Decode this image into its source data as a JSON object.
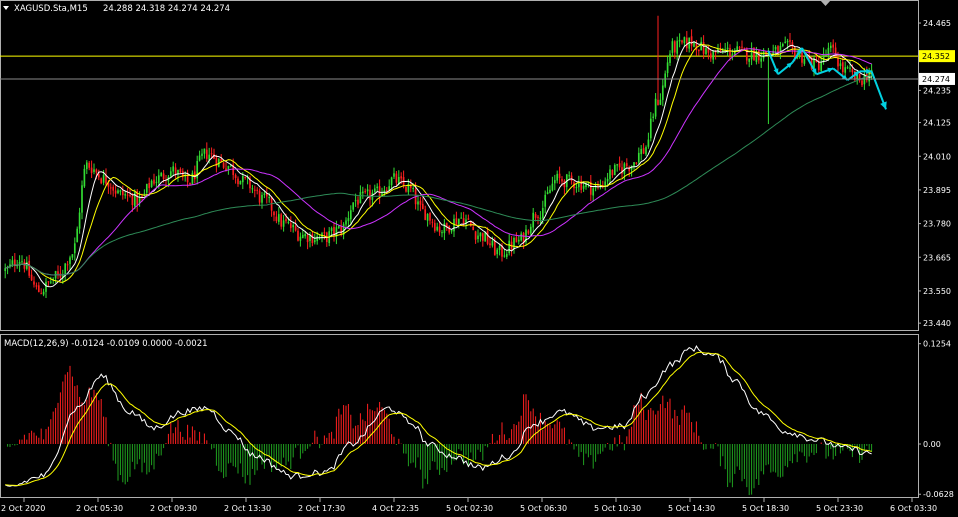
{
  "chart_data": {
    "type": "candlestick",
    "symbol_label": "XAGUSD.Sta,M15",
    "ohlc_label": "24.288 24.318 24.274 24.274",
    "price_axis": {
      "ylim": [
        23.42,
        24.53
      ],
      "ticks": [
        "24.465",
        "24.350",
        "24.235",
        "24.125",
        "24.010",
        "23.895",
        "23.780",
        "23.665",
        "23.550",
        "23.440"
      ]
    },
    "current_price": "24.274",
    "horizontal_line": {
      "value": "24.352",
      "color": "#ffff00"
    },
    "time_labels": [
      "2 Oct 2020",
      "2 Oct 05:30",
      "2 Oct 09:30",
      "2 Oct 13:30",
      "2 Oct 17:30",
      "4 Oct 22:35",
      "5 Oct 02:30",
      "5 Oct 06:30",
      "5 Oct 10:30",
      "5 Oct 14:30",
      "5 Oct 18:30",
      "5 Oct 23:30",
      "6 Oct 03:30"
    ],
    "price_keypoints": [
      [
        0,
        23.62
      ],
      [
        6,
        23.66
      ],
      [
        14,
        23.55
      ],
      [
        22,
        23.6
      ],
      [
        28,
        23.68
      ],
      [
        34,
        23.98
      ],
      [
        42,
        23.93
      ],
      [
        48,
        23.88
      ],
      [
        56,
        23.86
      ],
      [
        62,
        23.93
      ],
      [
        70,
        23.96
      ],
      [
        76,
        23.92
      ],
      [
        84,
        24.02
      ],
      [
        92,
        23.98
      ],
      [
        100,
        23.92
      ],
      [
        108,
        23.86
      ],
      [
        116,
        23.78
      ],
      [
        124,
        23.74
      ],
      [
        132,
        23.73
      ],
      [
        140,
        23.76
      ],
      [
        146,
        23.86
      ],
      [
        154,
        23.88
      ],
      [
        162,
        23.93
      ],
      [
        168,
        23.9
      ],
      [
        174,
        23.82
      ],
      [
        182,
        23.76
      ],
      [
        190,
        23.8
      ],
      [
        198,
        23.74
      ],
      [
        206,
        23.68
      ],
      [
        214,
        23.72
      ],
      [
        222,
        23.82
      ],
      [
        230,
        23.93
      ],
      [
        238,
        23.92
      ],
      [
        246,
        23.9
      ],
      [
        254,
        23.96
      ],
      [
        260,
        23.98
      ],
      [
        266,
        24.03
      ],
      [
        272,
        24.2
      ],
      [
        278,
        24.38
      ],
      [
        286,
        24.4
      ],
      [
        294,
        24.36
      ],
      [
        302,
        24.37
      ],
      [
        310,
        24.36
      ],
      [
        318,
        24.36
      ],
      [
        326,
        24.38
      ],
      [
        332,
        24.35
      ],
      [
        338,
        24.32
      ],
      [
        344,
        24.37
      ],
      [
        350,
        24.3
      ],
      [
        356,
        24.27
      ],
      [
        361,
        24.3
      ]
    ],
    "wicks": [
      {
        "index": 272,
        "high": 24.49,
        "low": 24.2
      },
      {
        "index": 318,
        "high": 24.38,
        "low": 24.12
      }
    ],
    "moving_averages": [
      {
        "period": 8,
        "color": "#ffffff"
      },
      {
        "period": 14,
        "color": "#ffff00"
      },
      {
        "period": 34,
        "color": "#cc33ff"
      },
      {
        "period": 110,
        "color": "#2e8b57"
      }
    ],
    "pattern_arrows": {
      "color": "#00d0e0",
      "points": [
        [
          318,
          24.37
        ],
        [
          322,
          24.29
        ],
        [
          328,
          24.33
        ],
        [
          332,
          24.38
        ],
        [
          338,
          24.29
        ],
        [
          345,
          24.31
        ],
        [
          351,
          24.27
        ],
        [
          356,
          24.3
        ],
        [
          361,
          24.3
        ],
        [
          367,
          24.17
        ]
      ]
    },
    "macd": {
      "label": "MACD(12,26,9) -0.0124 -0.0109 0.0000 -0.0021",
      "ylim": [
        -0.065,
        0.135
      ],
      "ticks": [
        "0.1254",
        "0.00",
        "-0.0628"
      ],
      "keypoints": [
        [
          0,
          -0.055
        ],
        [
          16,
          -0.04
        ],
        [
          30,
          0.045
        ],
        [
          40,
          0.085
        ],
        [
          52,
          0.04
        ],
        [
          62,
          0.02
        ],
        [
          74,
          0.04
        ],
        [
          84,
          0.045
        ],
        [
          94,
          0.015
        ],
        [
          104,
          -0.015
        ],
        [
          120,
          -0.04
        ],
        [
          134,
          -0.035
        ],
        [
          144,
          0.0
        ],
        [
          160,
          0.045
        ],
        [
          170,
          0.025
        ],
        [
          176,
          0.0
        ],
        [
          186,
          -0.015
        ],
        [
          198,
          -0.03
        ],
        [
          210,
          -0.015
        ],
        [
          220,
          0.025
        ],
        [
          232,
          0.04
        ],
        [
          246,
          0.02
        ],
        [
          258,
          0.022
        ],
        [
          266,
          0.06
        ],
        [
          278,
          0.1
        ],
        [
          286,
          0.12
        ],
        [
          296,
          0.11
        ],
        [
          304,
          0.08
        ],
        [
          314,
          0.04
        ],
        [
          326,
          0.015
        ],
        [
          338,
          0.005
        ],
        [
          350,
          -0.005
        ],
        [
          361,
          -0.012
        ]
      ],
      "colors": {
        "macd": "#ffffff",
        "signal": "#ffff00",
        "hist_pos": "#ff2020",
        "hist_neg": "#20a020"
      }
    }
  }
}
